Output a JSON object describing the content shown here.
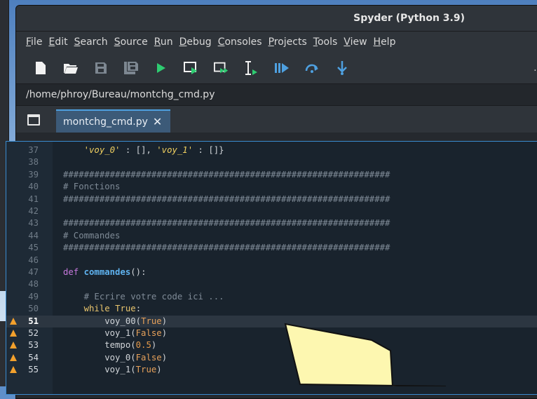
{
  "window": {
    "title": "Spyder (Python 3.9)"
  },
  "menu": [
    "File",
    "Edit",
    "Search",
    "Source",
    "Run",
    "Debug",
    "Consoles",
    "Projects",
    "Tools",
    "View",
    "Help"
  ],
  "toolbar": {
    "icons": [
      "new-file-icon",
      "open-folder-icon",
      "save-icon",
      "save-all-icon",
      "run-icon",
      "run-cell-icon",
      "run-cell-advance-icon",
      "run-selection-icon",
      "debug-icon",
      "step-over-icon",
      "step-into-icon"
    ],
    "more": "…"
  },
  "path": "/home/phroy/Bureau/montchg_cmd.py",
  "tab": {
    "label": "montchg_cmd.py",
    "close": "✕"
  },
  "code": {
    "lines": [
      {
        "n": "37",
        "text": "    'voy_0' : [], 'voy_1' : []}",
        "kind": "dict"
      },
      {
        "n": "38",
        "text": "",
        "kind": "plain"
      },
      {
        "n": "39",
        "text": "###############################################################",
        "kind": "hash"
      },
      {
        "n": "40",
        "text": "# Fonctions",
        "kind": "hash"
      },
      {
        "n": "41",
        "text": "###############################################################",
        "kind": "hash"
      },
      {
        "n": "42",
        "text": "",
        "kind": "plain"
      },
      {
        "n": "43",
        "text": "###############################################################",
        "kind": "hash"
      },
      {
        "n": "44",
        "text": "# Commandes",
        "kind": "hash"
      },
      {
        "n": "45",
        "text": "###############################################################",
        "kind": "hash"
      },
      {
        "n": "46",
        "text": "",
        "kind": "plain"
      },
      {
        "n": "47",
        "text": "def commandes():",
        "kind": "def"
      },
      {
        "n": "48",
        "text": "",
        "kind": "plain"
      },
      {
        "n": "49",
        "text": "    # Ecrire votre code ici ...",
        "kind": "comment"
      },
      {
        "n": "50",
        "text": "    while True:",
        "kind": "while"
      },
      {
        "n": "51",
        "text": "        voy_00(True)",
        "kind": "call",
        "warn": true,
        "current": true
      },
      {
        "n": "52",
        "text": "        voy_1(False)",
        "kind": "call",
        "warn": true
      },
      {
        "n": "53",
        "text": "        tempo(0.5)",
        "kind": "call",
        "warn": true
      },
      {
        "n": "54",
        "text": "        voy_0(False)",
        "kind": "call",
        "warn": true
      },
      {
        "n": "55",
        "text": "        voy_1(True)",
        "kind": "call",
        "warn": true
      }
    ]
  },
  "colors": {
    "accent": "#4ea0e0",
    "warning": "#f2a02c",
    "annotation": "#fdf7b0"
  }
}
